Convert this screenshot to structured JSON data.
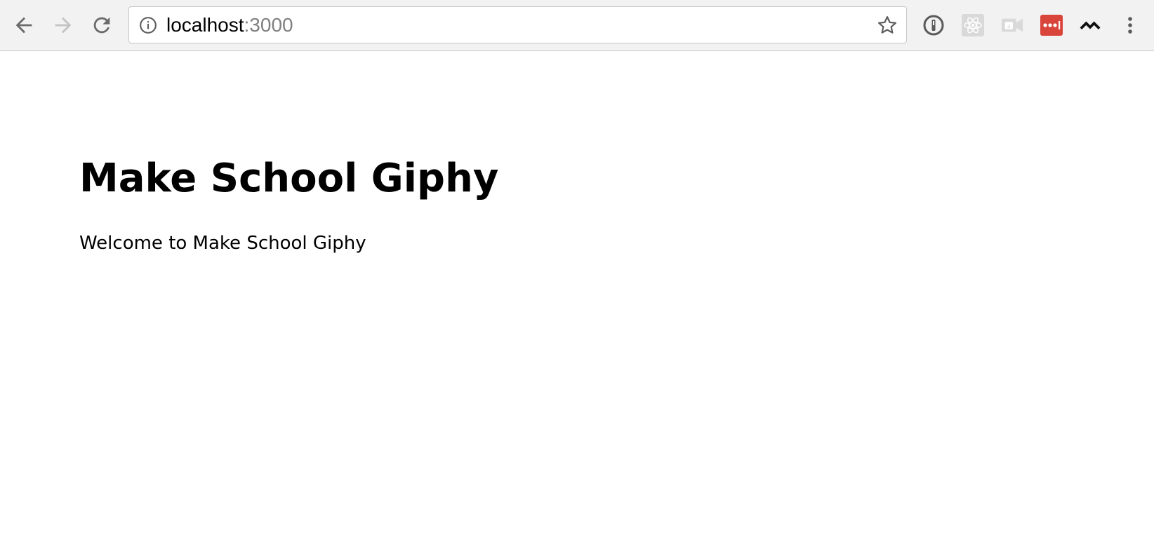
{
  "browser": {
    "address_bar": {
      "host": "localhost",
      "port": ":3000"
    },
    "icons": {
      "back": "back-arrow-icon",
      "forward": "forward-arrow-icon",
      "reload": "reload-icon",
      "site_info": "info-icon",
      "bookmark": "star-icon",
      "menu": "three-dots-menu-icon"
    },
    "extensions": [
      {
        "name": "1password-extension",
        "color": "#5a5a5a"
      },
      {
        "name": "react-devtools-extension",
        "color": "#d9d9d9"
      },
      {
        "name": "auto-refresh-extension",
        "color": "#d9d9d9"
      },
      {
        "name": "lastpass-extension",
        "color": "#d9453b"
      },
      {
        "name": "chevron-extension",
        "color": "#111111"
      }
    ]
  },
  "page": {
    "title": "Make School Giphy",
    "subtitle": "Welcome to Make School Giphy"
  }
}
